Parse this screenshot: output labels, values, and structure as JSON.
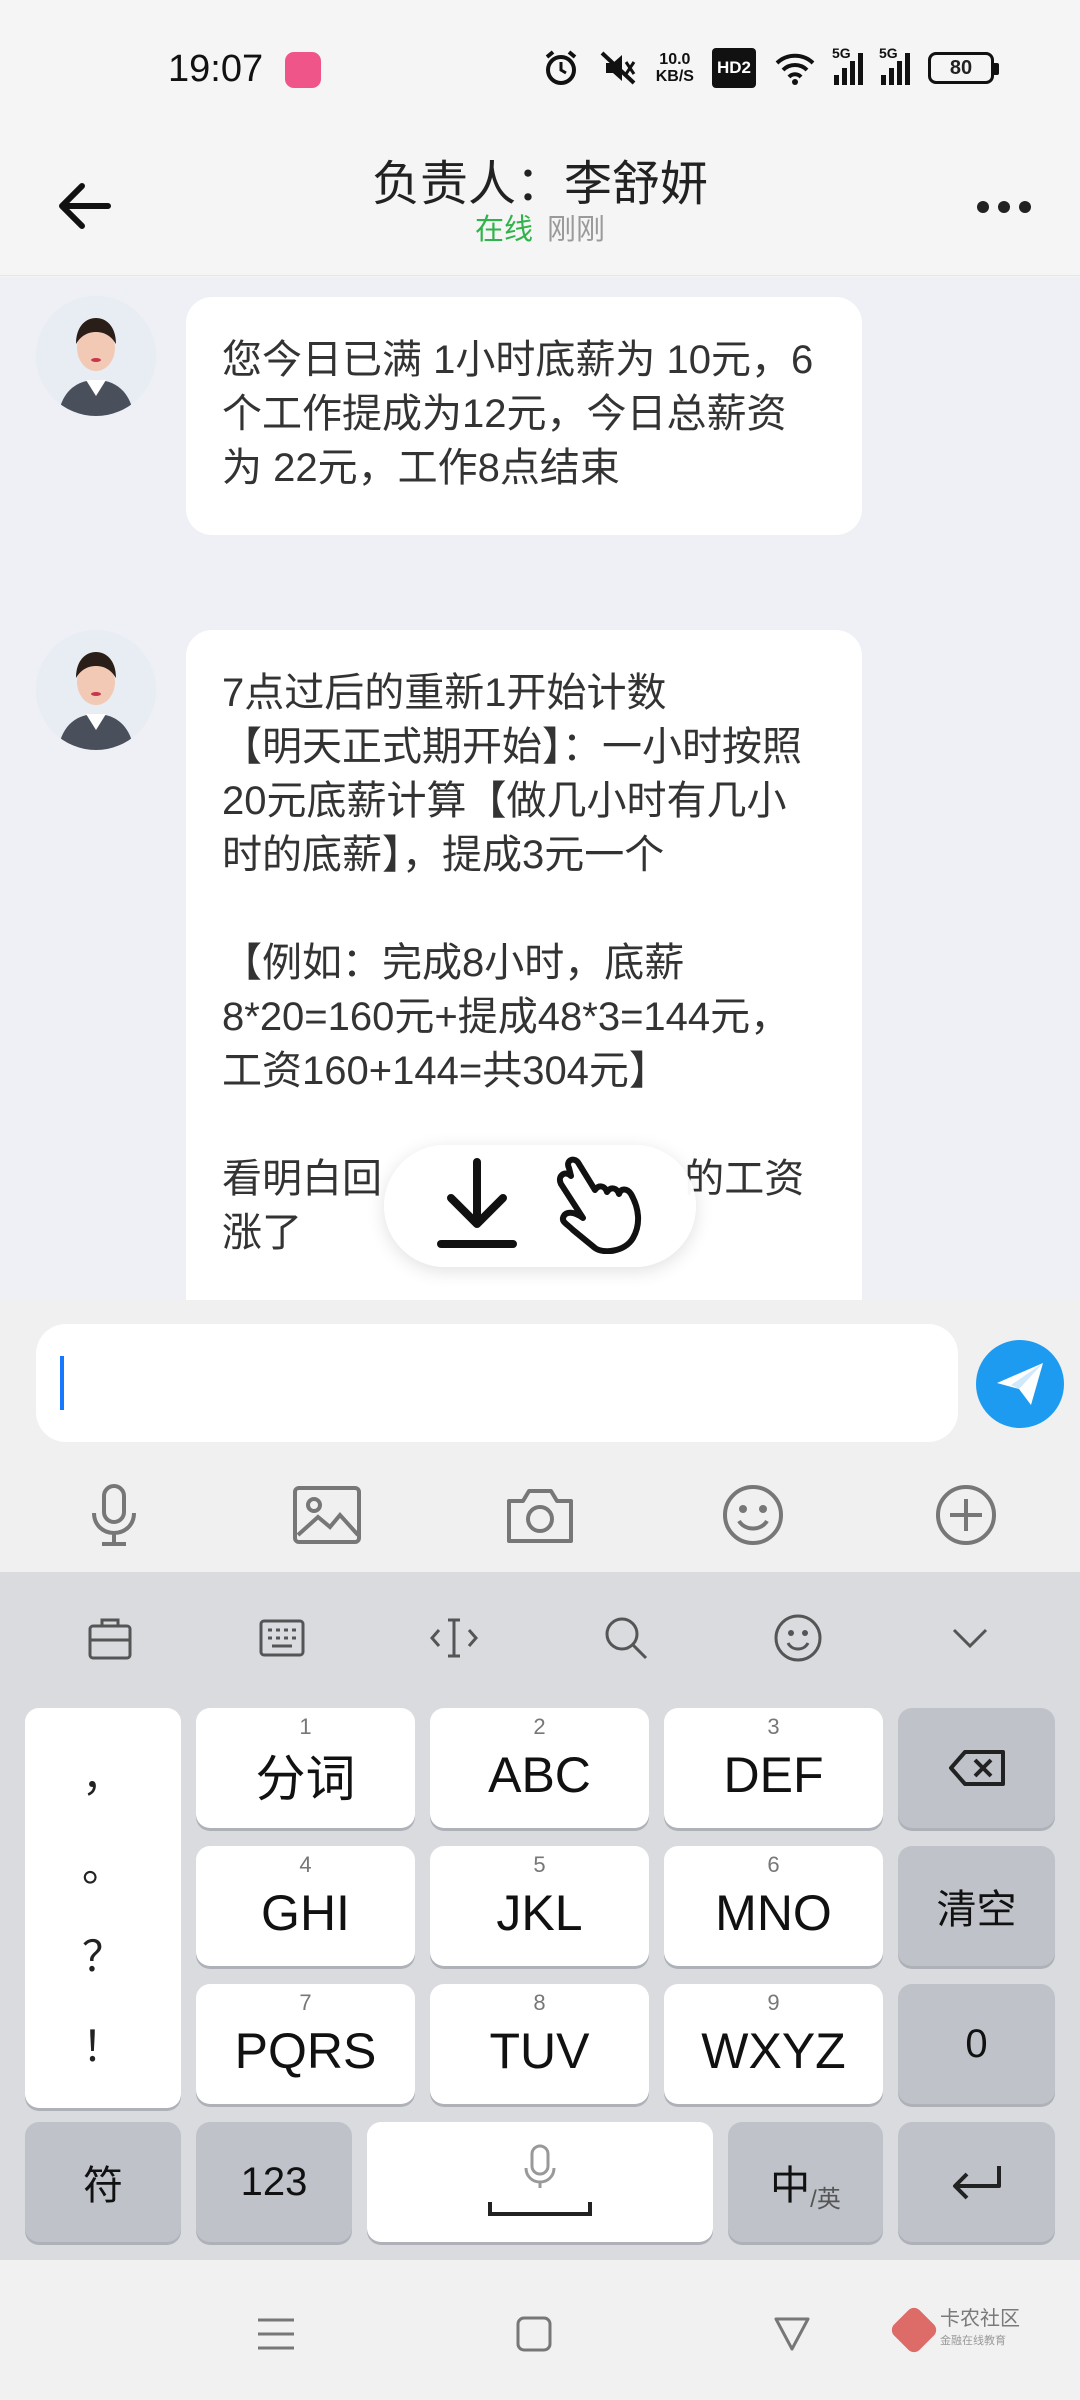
{
  "status_bar": {
    "time": "19:07",
    "net_speed_value": "10.0",
    "net_speed_unit": "KB/S",
    "hd_label": "HD2",
    "sim1_label": "5G",
    "sim2_label": "5G",
    "battery": "80"
  },
  "header": {
    "title": "负责人：李舒妍",
    "status_online": "在线",
    "status_time": "刚刚"
  },
  "messages": [
    {
      "text": "您今日已满 1小时底薪为 10元，6个工作提成为12元，今日总薪资为 22元，工作8点结束"
    },
    {
      "text": "7点过后的重新1开始计数\n【明天正式期开始】：一小时按照20元底薪计算【做几小时有几小时的底薪】，提成3元一个\n\n【例如：完成8小时，底薪8*20=160元+提成48*3=144元，工资160+144=共304元】\n\n看明白回 　　　　　　　 的工资涨了"
    }
  ],
  "input": {
    "value": "",
    "placeholder": ""
  },
  "toolbar": {
    "icons": [
      "microphone-icon",
      "image-icon",
      "camera-icon",
      "emoji-icon",
      "plus-icon"
    ]
  },
  "keyboard": {
    "top_icons": [
      "clipboard-icon",
      "keyboard-icon",
      "cursor-icon",
      "search-icon",
      "emoji-icon",
      "collapse-icon"
    ],
    "punctuation": [
      "，",
      "。",
      "？",
      "！"
    ],
    "keys": [
      {
        "num": "1",
        "label": "分词"
      },
      {
        "num": "2",
        "label": "ABC"
      },
      {
        "num": "3",
        "label": "DEF"
      },
      {
        "num": "4",
        "label": "GHI"
      },
      {
        "num": "5",
        "label": "JKL"
      },
      {
        "num": "6",
        "label": "MNO"
      },
      {
        "num": "7",
        "label": "PQRS"
      },
      {
        "num": "8",
        "label": "TUV"
      },
      {
        "num": "9",
        "label": "WXYZ"
      }
    ],
    "clear_label": "清空",
    "zero_label": "0",
    "symbol_label": "符",
    "num_label": "123",
    "lang_main": "中",
    "lang_sub": "/英"
  },
  "watermark": {
    "name": "卡农社区",
    "tagline": "金融在线教育"
  },
  "colors": {
    "accent": "#1d9bf0",
    "online": "#2fb34a"
  }
}
